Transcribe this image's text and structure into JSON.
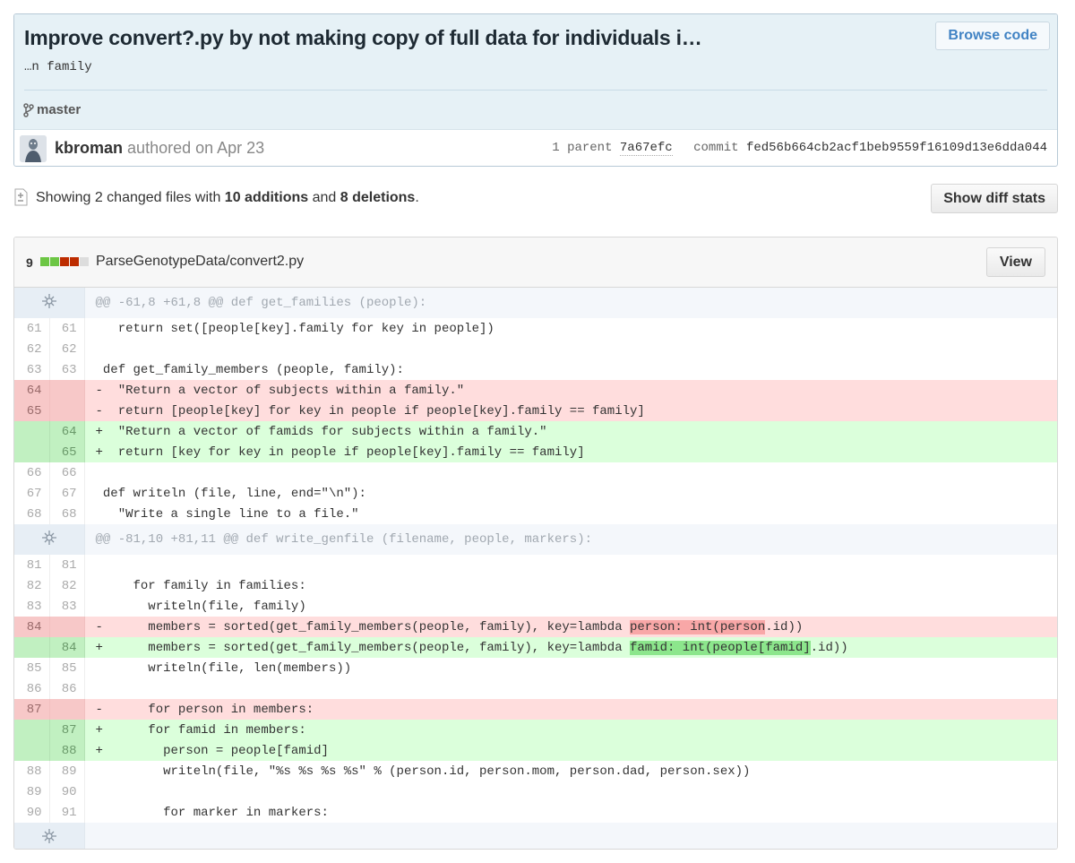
{
  "commit": {
    "title": "Improve convert?.py by not making copy of full data for individuals i…",
    "description": "…n family",
    "browse_label": "Browse code",
    "branch": "master",
    "author": "kbroman",
    "authored": "authored on Apr 23",
    "parent_label": "1 parent",
    "parent_sha": "7a67efc",
    "commit_label": "commit",
    "commit_sha": "fed56b664cb2acf1beb9559f16109d13e6dda044"
  },
  "toc": {
    "prefix": "Showing 2 changed files with ",
    "additions": "10 additions",
    "mid": " and ",
    "deletions": "8 deletions",
    "suffix": ".",
    "diff_stats_label": "Show diff stats"
  },
  "file": {
    "change_count": "9",
    "path": "ParseGenotypeData/convert2.py",
    "view_label": "View",
    "diffstat_colors": [
      "#6cc644",
      "#6cc644",
      "#bd2c00",
      "#bd2c00",
      "#dddddd"
    ]
  },
  "hunks": [
    {
      "header": "@@ -61,8 +61,8 @@ def get_families (people):",
      "lines": [
        {
          "type": "ctx",
          "old": "61",
          "new": "61",
          "code": "   return set([people[key].family for key in people])"
        },
        {
          "type": "ctx",
          "old": "62",
          "new": "62",
          "code": ""
        },
        {
          "type": "ctx",
          "old": "63",
          "new": "63",
          "code": " def get_family_members (people, family):"
        },
        {
          "type": "del",
          "old": "64",
          "new": "",
          "code": "-  \"Return a vector of subjects within a family.\""
        },
        {
          "type": "del",
          "old": "65",
          "new": "",
          "code": "-  return [people[key] for key in people if people[key].family == family]"
        },
        {
          "type": "add",
          "old": "",
          "new": "64",
          "code": "+  \"Return a vector of famids for subjects within a family.\""
        },
        {
          "type": "add",
          "old": "",
          "new": "65",
          "code": "+  return [key for key in people if people[key].family == family]"
        },
        {
          "type": "ctx",
          "old": "66",
          "new": "66",
          "code": ""
        },
        {
          "type": "ctx",
          "old": "67",
          "new": "67",
          "code": " def writeln (file, line, end=\"\\n\"):"
        },
        {
          "type": "ctx",
          "old": "68",
          "new": "68",
          "code": "   \"Write a single line to a file.\""
        }
      ]
    },
    {
      "header": "@@ -81,10 +81,11 @@ def write_genfile (filename, people, markers):",
      "lines": [
        {
          "type": "ctx",
          "old": "81",
          "new": "81",
          "code": ""
        },
        {
          "type": "ctx",
          "old": "82",
          "new": "82",
          "code": "     for family in families:"
        },
        {
          "type": "ctx",
          "old": "83",
          "new": "83",
          "code": "       writeln(file, family)"
        },
        {
          "type": "del",
          "old": "84",
          "new": "",
          "code": "-      members = sorted(get_family_members(people, family), key=lambda ",
          "hl": "person: int(person",
          "tail": ".id))"
        },
        {
          "type": "add",
          "old": "",
          "new": "84",
          "code": "+      members = sorted(get_family_members(people, family), key=lambda ",
          "hl": "famid: int(people[famid]",
          "tail": ".id))"
        },
        {
          "type": "ctx",
          "old": "85",
          "new": "85",
          "code": "       writeln(file, len(members))"
        },
        {
          "type": "ctx",
          "old": "86",
          "new": "86",
          "code": ""
        },
        {
          "type": "del",
          "old": "87",
          "new": "",
          "code": "-      for person in members:"
        },
        {
          "type": "add",
          "old": "",
          "new": "87",
          "code": "+      for famid in members:"
        },
        {
          "type": "add",
          "old": "",
          "new": "88",
          "code": "+        person = people[famid]"
        },
        {
          "type": "ctx",
          "old": "88",
          "new": "89",
          "code": "         writeln(file, \"%s %s %s %s\" % (person.id, person.mom, person.dad, person.sex))"
        },
        {
          "type": "ctx",
          "old": "89",
          "new": "90",
          "code": ""
        },
        {
          "type": "ctx",
          "old": "90",
          "new": "91",
          "code": "         for marker in markers:"
        }
      ]
    }
  ]
}
